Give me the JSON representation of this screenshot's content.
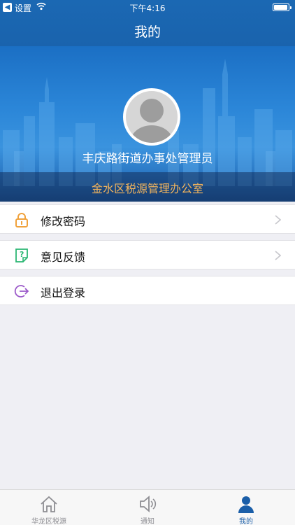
{
  "status_bar": {
    "carrier": "设置",
    "time": "下午4:16",
    "battery_level": 0.95
  },
  "nav": {
    "title": "我的"
  },
  "profile": {
    "user_name": "丰庆路街道办事处管理员",
    "office": "金水区税源管理办公室"
  },
  "menu": [
    {
      "label": "修改密码",
      "icon": "lock-icon",
      "color": "#f0a23c"
    },
    {
      "label": "意见反馈",
      "icon": "feedback-icon",
      "color": "#2bb673"
    },
    {
      "label": "退出登录",
      "icon": "logout-icon",
      "color": "#9b59c9"
    }
  ],
  "tabs": [
    {
      "label": "华龙区税源",
      "icon": "home-icon"
    },
    {
      "label": "通知",
      "icon": "speaker-icon"
    },
    {
      "label": "我的",
      "icon": "person-icon",
      "active": true
    }
  ],
  "colors": {
    "brand": "#1b68b3",
    "accent_text": "#f0b35d",
    "active_tab": "#1a5ea8"
  }
}
